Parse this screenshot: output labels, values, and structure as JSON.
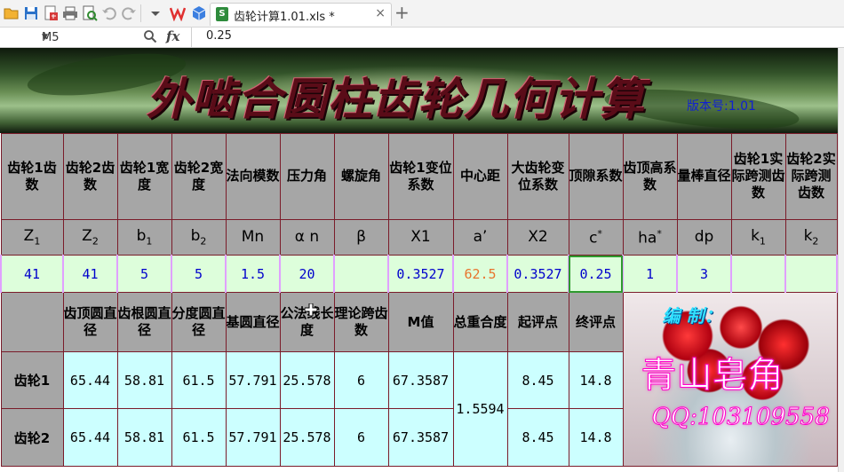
{
  "toolbar": {
    "icons": [
      "open-folder-icon",
      "save-icon",
      "save-as-icon",
      "print-icon",
      "print-preview-icon",
      "undo-icon",
      "redo-icon",
      "dropdown-icon",
      "wps-logo-icon",
      "cube-icon"
    ],
    "tab_title": "齿轮计算1.01.xls *",
    "tab_close": "×",
    "add_tab": "+"
  },
  "formula_bar": {
    "cell_ref": "M5",
    "fx_label": "fx",
    "value": "0.25"
  },
  "banner": {
    "title": "外啮合圆柱齿轮几何计算",
    "version": "版本号:1.01"
  },
  "headers": [
    "齿轮1齿数",
    "齿轮2齿数",
    "齿轮1宽度",
    "齿轮2宽度",
    "法向模数",
    "压力角",
    "螺旋角",
    "齿轮1变位系数",
    "中心距",
    "大齿轮变位系数",
    "顶隙系数",
    "齿顶高系数",
    "量棒直径",
    "齿轮1实际跨测齿数",
    "齿轮2实际跨测齿数"
  ],
  "symbols": {
    "z1_base": "Z",
    "z1_sub": "1",
    "z2_base": "Z",
    "z2_sub": "2",
    "b1_base": "b",
    "b1_sub": "1",
    "b2_base": "b",
    "b2_sub": "2",
    "mn": "Mn",
    "alpha_n": "α n",
    "beta": "β",
    "x1": "X1",
    "a_prime": "a’",
    "x2": "X2",
    "c_base": "c",
    "c_sup": "*",
    "ha_base": "ha",
    "ha_sup": "*",
    "dp": "dp",
    "k1_base": "k",
    "k1_sub": "1",
    "k2_base": "k",
    "k2_sub": "2"
  },
  "inputs": [
    "41",
    "41",
    "5",
    "5",
    "1.5",
    "20",
    "",
    "0.3527",
    "62.5",
    "0.3527",
    "0.25",
    "1",
    "3",
    "",
    ""
  ],
  "result_headers": [
    "齿顶圆直径",
    "齿根圆直径",
    "分度圆直径",
    "基圆直径",
    "公法线长度",
    "理论跨齿数",
    "M值",
    "总重合度",
    "起评点",
    "终评点"
  ],
  "rows": [
    {
      "label": "齿轮1",
      "values": [
        "65.44",
        "58.81",
        "61.5",
        "57.791",
        "25.578",
        "6",
        "67.3587"
      ],
      "start": "8.45",
      "end": "14.8"
    },
    {
      "label": "齿轮2",
      "values": [
        "65.44",
        "58.81",
        "61.5",
        "57.791",
        "25.578",
        "6",
        "67.3587"
      ],
      "start": "8.45",
      "end": "14.8"
    }
  ],
  "total_contact_ratio": "1.5594",
  "promo": {
    "label": "编 制：",
    "name": "青山皂角",
    "qq": "QQ:103109558"
  },
  "colors": {
    "header_bg": "#a6a6a6",
    "input_bg": "#ddfedb",
    "output_bg": "#ccffff",
    "grid_line": "#7a1c2a",
    "input_text": "#0000cc",
    "center_distance_text": "#e8742e"
  }
}
